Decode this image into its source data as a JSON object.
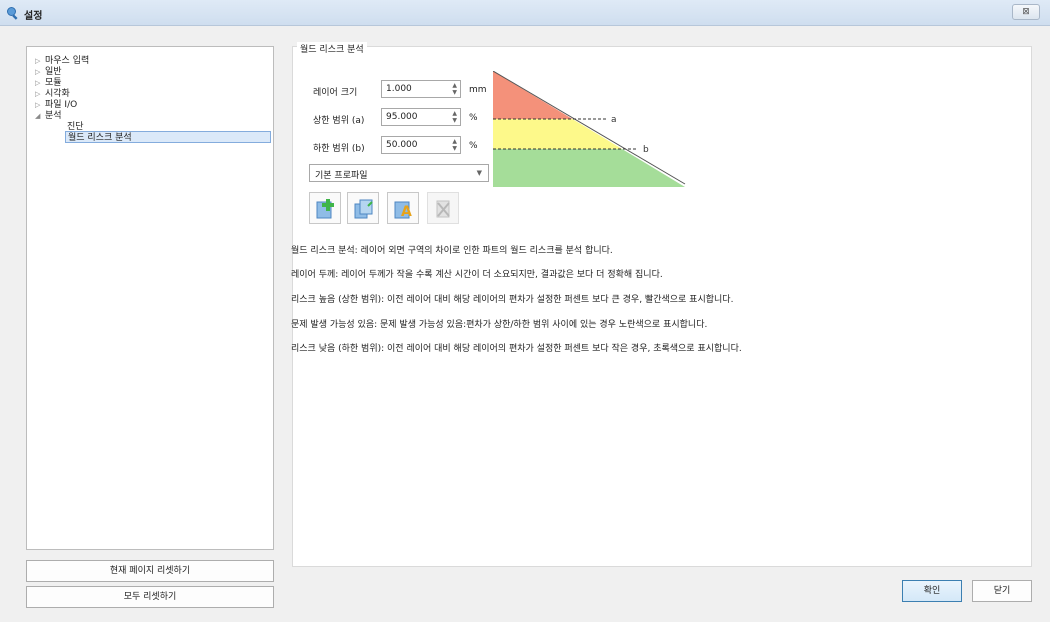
{
  "window": {
    "title": "설정",
    "close_label": "⊠"
  },
  "tree": {
    "items": [
      {
        "label": "마우스 입력",
        "arrow": "▷"
      },
      {
        "label": "일반",
        "arrow": "▷"
      },
      {
        "label": "모듈",
        "arrow": "▷"
      },
      {
        "label": "시각화",
        "arrow": "▷"
      },
      {
        "label": "파일 I/O",
        "arrow": "▷"
      },
      {
        "label": "분석",
        "arrow": "◢"
      },
      {
        "label": "진단",
        "arrow": ""
      },
      {
        "label": "월드 리스크 분석",
        "arrow": ""
      }
    ],
    "selected_index": 7
  },
  "left_buttons": {
    "reset_page": "현재 페이지 리셋하기",
    "reset_all": "모두 리셋하기"
  },
  "main": {
    "group_title": "월드 리스크 분석",
    "layer_size": {
      "label": "레이어 크기",
      "value": "1.000",
      "unit": "mm"
    },
    "upper_limit": {
      "label": "상한 범위 (a)",
      "value": "95.000",
      "unit": "%"
    },
    "lower_limit": {
      "label": "하한 범위 (b)",
      "value": "50.000",
      "unit": "%"
    },
    "profile": {
      "value": "기본 프로파일"
    },
    "diagram_labels": {
      "a": "a",
      "b": "b"
    },
    "colors": {
      "red": "#f4917a",
      "yellow": "#fdf98a",
      "green": "#a5dd99"
    },
    "descriptions": [
      "월드 리스크 분석: 레이어 외면 구역의 차이로 인한 파트의 월드 리스크를 분석 합니다.",
      "레이어 두께: 레이어 두께가 작을 수록 계산 시간이 더 소요되지만, 결과값은 보다 더 정확해 집니다.",
      "리스크 높음 (상한 범위): 이전 레이어 대비 해당 레이어의 편차가 설정한 퍼센트 보다 큰 경우, 빨간색으로 표시합니다.",
      "문제 발생 가능성 있음: 문제 발생 가능성 있음:편차가 상한/하한 범위 사이에 있는 경우 노란색으로 표시합니다.",
      "리스크 낮음 (하한 범위): 이전 레이어 대비 해당 레이어의 편차가 설정한 퍼센트 보다 작은 경우, 초록색으로 표시합니다."
    ],
    "tool_icons": [
      "add-profile-icon",
      "copy-profile-icon",
      "rename-profile-icon",
      "delete-profile-icon"
    ]
  },
  "dialog_buttons": {
    "ok": "확인",
    "close": "닫기"
  }
}
